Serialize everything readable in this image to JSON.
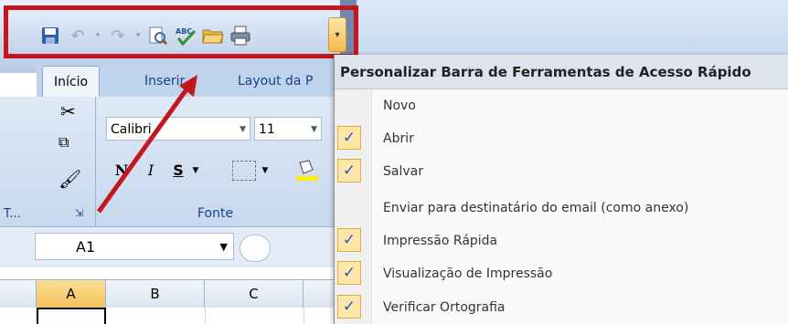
{
  "qat": {
    "icons": [
      "save-icon",
      "undo-icon",
      "redo-icon",
      "print-preview-icon",
      "spelling-icon",
      "open-folder-icon",
      "quick-print-icon"
    ],
    "dropdown_glyph": "▾"
  },
  "ribbon": {
    "tabs": [
      {
        "label": "Início",
        "active": true
      },
      {
        "label": "Inserir",
        "active": false
      },
      {
        "label": "Layout da P",
        "active": false
      }
    ],
    "font_name": "Calibri",
    "font_size": "11",
    "bold": "N",
    "italic": "I",
    "underline": "S",
    "clipboard_label": "T...",
    "font_group_label": "Fonte"
  },
  "formula_bar": {
    "name_box": "A1"
  },
  "columns": [
    "A",
    "B",
    "C"
  ],
  "menu": {
    "title": "Personalizar Barra de Ferramentas de Acesso Rápido",
    "items": [
      {
        "label": "Novo",
        "checked": false
      },
      {
        "label": "Abrir",
        "checked": true
      },
      {
        "label": "Salvar",
        "checked": true
      },
      {
        "label": "Enviar para destinatário do email (como anexo)",
        "checked": false
      },
      {
        "label": "Impressão Rápida",
        "checked": true
      },
      {
        "label": "Visualização de Impressão",
        "checked": true
      },
      {
        "label": "Verificar Ortografia",
        "checked": true
      }
    ],
    "check_glyph": "✓"
  },
  "colors": {
    "highlight_border": "#c4161c",
    "arrow": "#c4161c",
    "check_bg": "#fde6a8"
  }
}
